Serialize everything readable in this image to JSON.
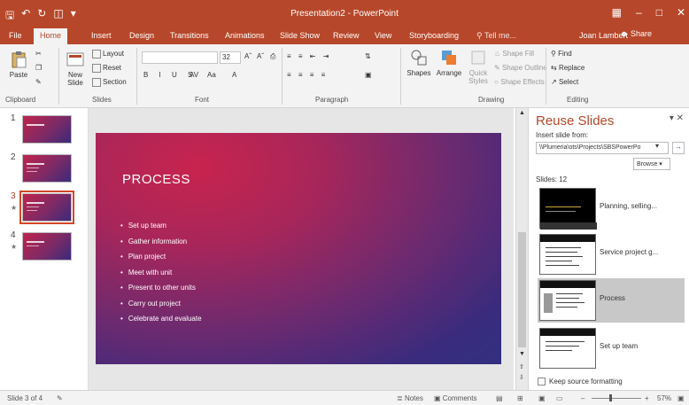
{
  "window": {
    "title": "Presentation2 - PowerPoint"
  },
  "tabs": [
    "File",
    "Home",
    "Insert",
    "Design",
    "Transitions",
    "Animations",
    "Slide Show",
    "Review",
    "View",
    "Storyboarding"
  ],
  "tell_me": "Tell me...",
  "user": "Joan Lambert",
  "share": "Share",
  "ribbon": {
    "clipboard": {
      "paste": "Paste",
      "label": "Clipboard"
    },
    "slides": {
      "new_slide": "New Slide",
      "layout": "Layout",
      "reset": "Reset",
      "section": "Section",
      "label": "Slides"
    },
    "font": {
      "size": "32",
      "label": "Font"
    },
    "paragraph": {
      "label": "Paragraph"
    },
    "drawing": {
      "shapes": "Shapes",
      "arrange": "Arrange",
      "quick_styles": "Quick Styles",
      "shape_fill": "Shape Fill",
      "shape_outline": "Shape Outline",
      "shape_effects": "Shape Effects",
      "label": "Drawing"
    },
    "editing": {
      "find": "Find",
      "replace": "Replace",
      "select": "Select",
      "label": "Editing"
    }
  },
  "thumbnails": [
    {
      "num": "1"
    },
    {
      "num": "2"
    },
    {
      "num": "3"
    },
    {
      "num": "4"
    }
  ],
  "slide": {
    "title": "PROCESS",
    "bullets": [
      "Set up team",
      "Gather information",
      "Plan project",
      "Meet with unit",
      "Present to other units",
      "Carry out project",
      "Celebrate and evaluate"
    ]
  },
  "reuse": {
    "title": "Reuse Slides",
    "insert_from": "Insert slide from:",
    "path": "\\\\Plumeria\\ots\\Projects\\SBSPowerPo",
    "browse": "Browse",
    "slides_count": "Slides: 12",
    "items": [
      {
        "label": "Planning, selling..."
      },
      {
        "label": "Service project g..."
      },
      {
        "label": "Process"
      },
      {
        "label": "Set up team"
      }
    ],
    "keep_formatting": "Keep source formatting"
  },
  "status": {
    "slide_of": "Slide 3 of 4",
    "notes": "Notes",
    "comments": "Comments",
    "zoom": "57%"
  },
  "colors": {
    "accent": "#b7472a"
  }
}
